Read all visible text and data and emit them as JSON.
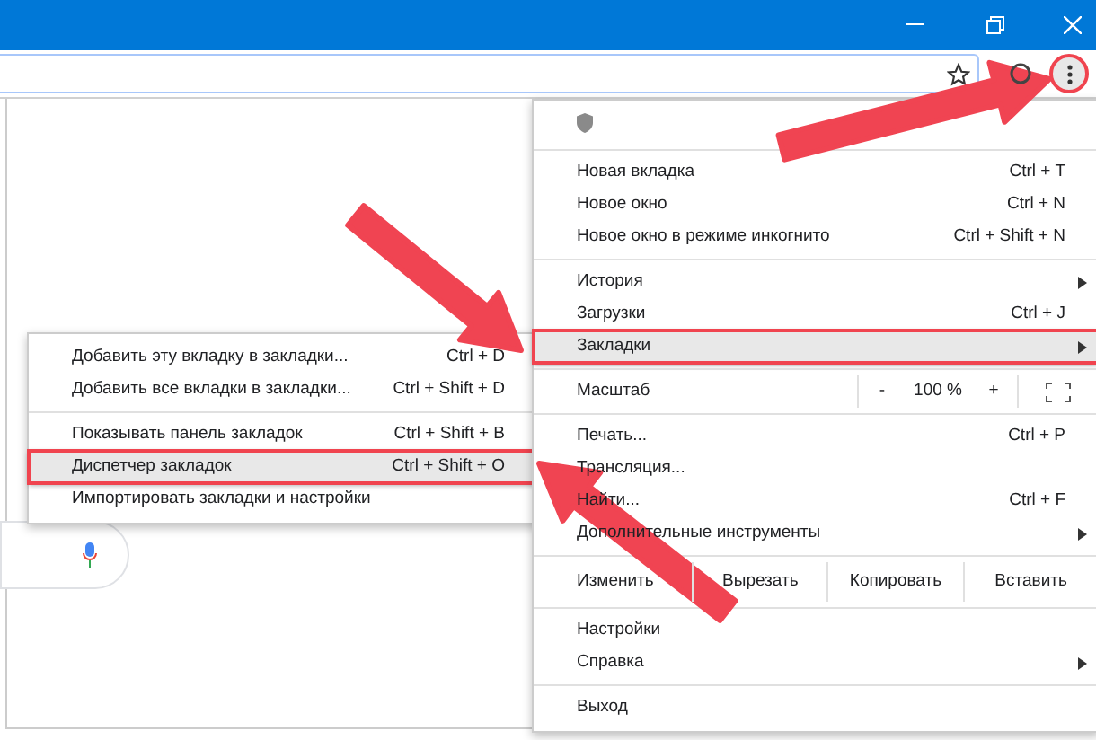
{
  "toolbar": {
    "menu_button_highlighted": true
  },
  "menu": {
    "items": [
      {
        "kind": "shield"
      },
      {
        "kind": "separator"
      },
      {
        "kind": "item",
        "label": "Новая вкладка",
        "shortcut": "Ctrl + T",
        "selected": false
      },
      {
        "kind": "item",
        "label": "Новое окно",
        "shortcut": "Ctrl + N",
        "selected": false
      },
      {
        "kind": "item",
        "label": "Новое окно в режиме инкогнито",
        "shortcut": "Ctrl + Shift + N",
        "selected": false
      },
      {
        "kind": "separator"
      },
      {
        "kind": "submenu",
        "label": "История",
        "selected": false
      },
      {
        "kind": "item",
        "label": "Загрузки",
        "shortcut": "Ctrl + J",
        "selected": false
      },
      {
        "kind": "submenu",
        "label": "Закладки",
        "selected": true
      },
      {
        "kind": "separator"
      },
      {
        "kind": "zoom",
        "label": "Масштаб",
        "minus": "-",
        "value": "100 %",
        "plus": "+"
      },
      {
        "kind": "separator"
      },
      {
        "kind": "item",
        "label": "Печать...",
        "shortcut": "Ctrl + P",
        "selected": false
      },
      {
        "kind": "item",
        "label": "Трансляция...",
        "selected": false
      },
      {
        "kind": "item",
        "label": "Найти...",
        "shortcut": "Ctrl + F",
        "selected": false
      },
      {
        "kind": "submenu",
        "label": "Дополнительные инструменты",
        "selected": false
      },
      {
        "kind": "separator"
      },
      {
        "kind": "edit",
        "label": "Изменить",
        "buttons": [
          "Вырезать",
          "Копировать",
          "Вставить"
        ]
      },
      {
        "kind": "separator"
      },
      {
        "kind": "item",
        "label": "Настройки",
        "selected": false
      },
      {
        "kind": "submenu",
        "label": "Справка",
        "selected": false
      },
      {
        "kind": "separator"
      },
      {
        "kind": "item",
        "label": "Выход",
        "selected": false
      }
    ]
  },
  "bookmarks_menu": {
    "items": [
      {
        "kind": "item",
        "label": "Добавить эту вкладку в закладки...",
        "shortcut": "Ctrl + D",
        "selected": false
      },
      {
        "kind": "item",
        "label": "Добавить все вкладки в закладки...",
        "shortcut": "Ctrl + Shift + D",
        "selected": false
      },
      {
        "kind": "separator"
      },
      {
        "kind": "item",
        "label": "Показывать панель закладок",
        "shortcut": "Ctrl + Shift + B",
        "selected": false
      },
      {
        "kind": "item",
        "label": "Диспетчер закладок",
        "shortcut": "Ctrl + Shift + O",
        "selected": true
      },
      {
        "kind": "item",
        "label": "Импортировать закладки и настройки",
        "selected": false
      }
    ]
  }
}
